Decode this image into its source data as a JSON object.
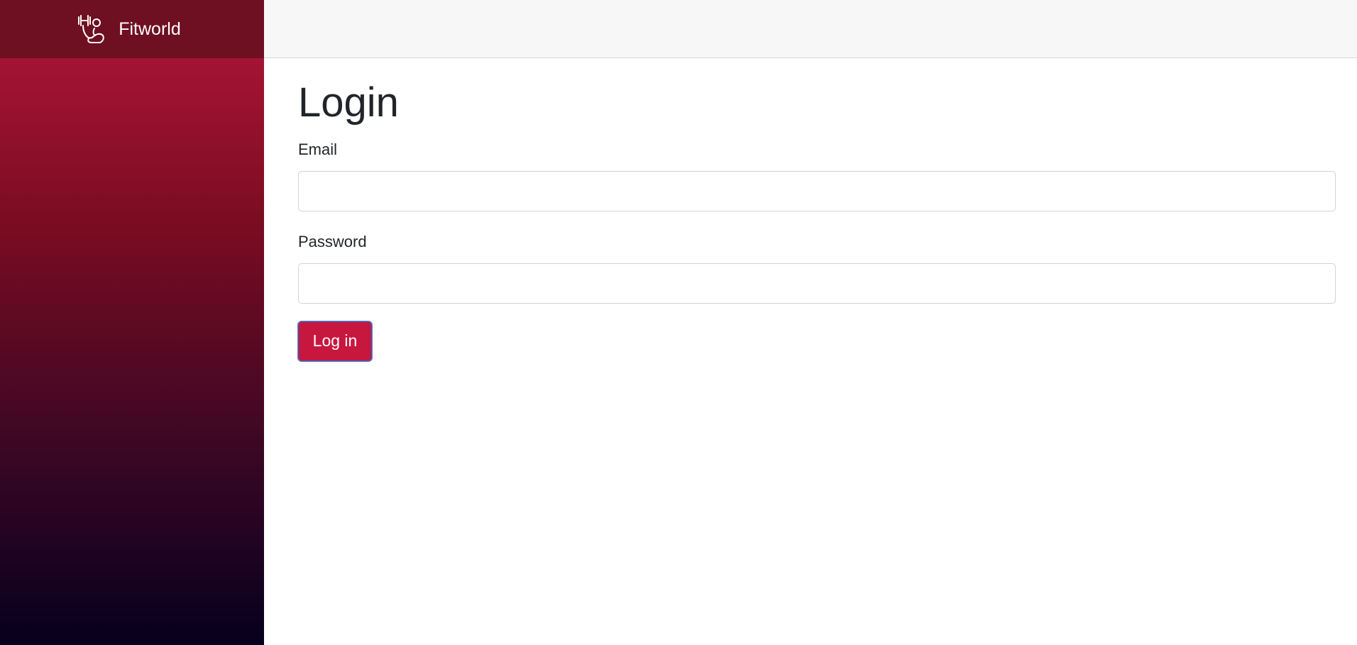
{
  "brand": {
    "name": "Fitworld",
    "icon": "fitness-logo-icon"
  },
  "login": {
    "title": "Login",
    "email_label": "Email",
    "email_value": "",
    "password_label": "Password",
    "password_value": "",
    "submit_label": "Log in"
  },
  "colors": {
    "brand_bar": "#6e0f22",
    "sidebar_top": "#b3163a",
    "sidebar_bottom": "#05001e",
    "button": "#c8173f",
    "topbar": "#f7f7f7"
  }
}
